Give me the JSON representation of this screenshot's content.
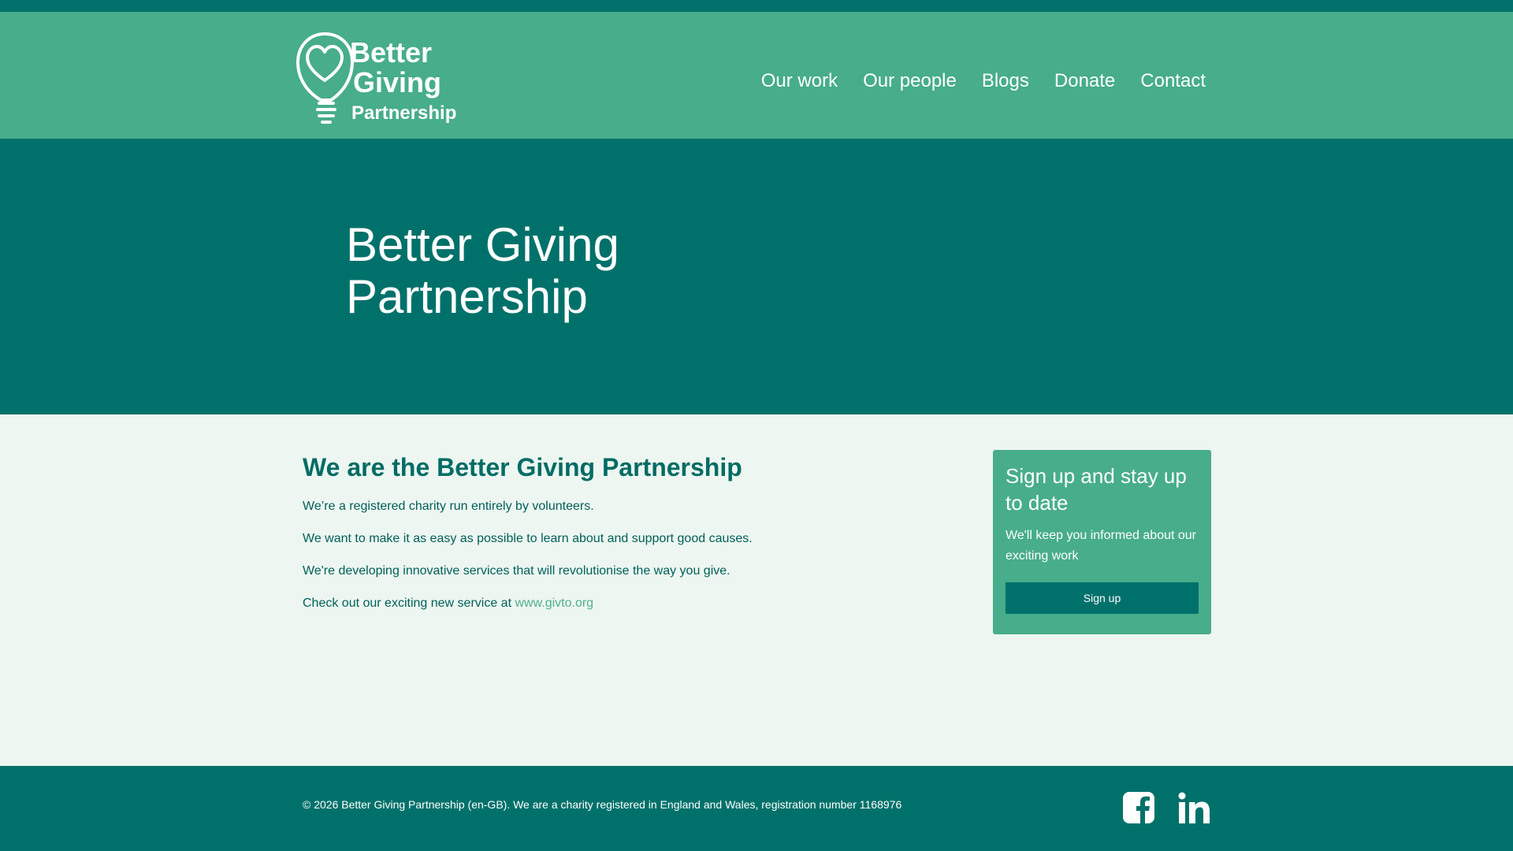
{
  "colors": {
    "top_strip": "#00716a",
    "header_bg": "#47ad8a",
    "hero_bg": "#00716a",
    "body_bg": "#edf6f1",
    "card_bg": "#47ad8a",
    "button_bg": "#00716a",
    "link": "#4fb08d"
  },
  "header": {
    "logo_alt_lines": [
      "Better",
      "Giving",
      "Partnership"
    ],
    "nav": [
      {
        "label": "Our work"
      },
      {
        "label": "Our people"
      },
      {
        "label": "Blogs"
      },
      {
        "label": "Donate"
      },
      {
        "label": "Contact"
      }
    ]
  },
  "hero": {
    "title": "Better Giving Partnership"
  },
  "intro": {
    "heading": "We are the Better Giving Partnership",
    "paragraphs": [
      "We’re a registered charity run entirely by volunteers.",
      "We want to make it as easy as possible to learn about and support good causes.",
      "We're developing innovative services that will revolutionise the way you give."
    ],
    "cta_prefix": "Check out our exciting new service at ",
    "cta_link": "www.givto.org"
  },
  "signup": {
    "title": "Sign up and stay up to date",
    "text": "We'll keep you informed about our exciting work",
    "button": "Sign up"
  },
  "footer": {
    "copyright": "© 2026 Better Giving Partnership (en-GB). We are a charity registered in England and Wales, registration number 1168976",
    "social": [
      {
        "name": "facebook-icon"
      },
      {
        "name": "linkedin-icon"
      }
    ]
  }
}
